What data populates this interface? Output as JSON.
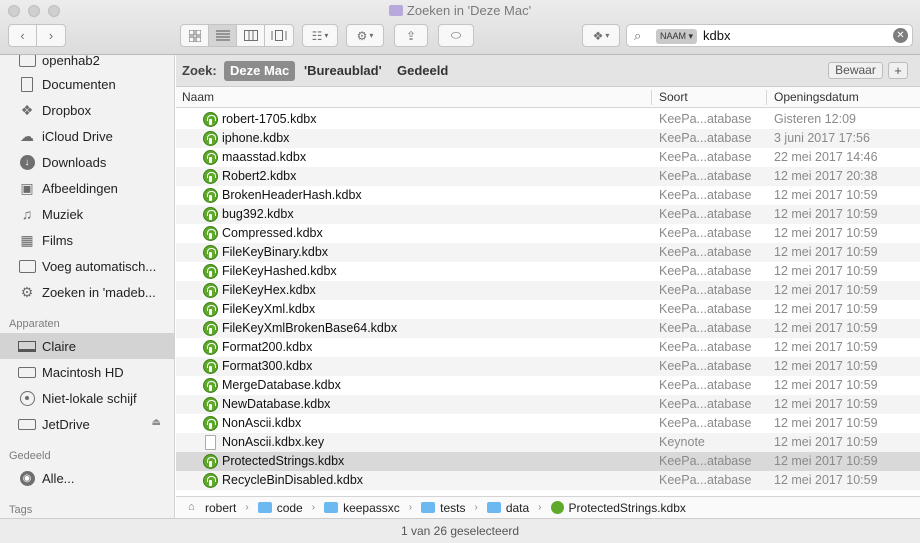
{
  "window": {
    "title": "Zoeken in 'Deze Mac'"
  },
  "toolbar": {
    "back_icon": "chevron-left-icon",
    "forward_icon": "chevron-right-icon",
    "search_token": "NAAM",
    "search_query": "kdbx"
  },
  "sidebar": {
    "top_items": [
      {
        "label": "openhab2",
        "icon": "folder-icon"
      },
      {
        "label": "Documenten",
        "icon": "documents-icon"
      },
      {
        "label": "Dropbox",
        "icon": "dropbox-icon"
      },
      {
        "label": "iCloud Drive",
        "icon": "cloud-icon"
      },
      {
        "label": "Downloads",
        "icon": "download-icon"
      },
      {
        "label": "Afbeeldingen",
        "icon": "camera-icon"
      },
      {
        "label": "Muziek",
        "icon": "music-icon"
      },
      {
        "label": "Films",
        "icon": "film-icon"
      },
      {
        "label": "Voeg automatisch...",
        "icon": "folder-icon"
      },
      {
        "label": "Zoeken in 'madeb...",
        "icon": "gear-icon"
      }
    ],
    "devices_heading": "Apparaten",
    "devices": [
      {
        "label": "Claire",
        "icon": "laptop-icon"
      },
      {
        "label": "Macintosh HD",
        "icon": "drive-icon"
      },
      {
        "label": "Niet-lokale schijf",
        "icon": "disc-icon"
      },
      {
        "label": "JetDrive",
        "icon": "drive-icon"
      }
    ],
    "shared_heading": "Gedeeld",
    "shared": [
      {
        "label": "Alle...",
        "icon": "network-icon"
      }
    ],
    "tags_heading": "Tags"
  },
  "scope": {
    "label": "Zoek:",
    "options": [
      "Deze Mac",
      "'Bureaublad'",
      "Gedeeld"
    ],
    "save_label": "Bewaar",
    "add_label": "+"
  },
  "columns": {
    "name": "Naam",
    "kind": "Soort",
    "date": "Openingsdatum"
  },
  "files": [
    {
      "name": "robert-1705.kdbx",
      "kind": "KeePa...atabase",
      "date": "Gisteren 12:09"
    },
    {
      "name": "iphone.kdbx",
      "kind": "KeePa...atabase",
      "date": "3 juni 2017 17:56"
    },
    {
      "name": "maasstad.kdbx",
      "kind": "KeePa...atabase",
      "date": "22 mei 2017 14:46"
    },
    {
      "name": "Robert2.kdbx",
      "kind": "KeePa...atabase",
      "date": "12 mei 2017 20:38"
    },
    {
      "name": "BrokenHeaderHash.kdbx",
      "kind": "KeePa...atabase",
      "date": "12 mei 2017 10:59"
    },
    {
      "name": "bug392.kdbx",
      "kind": "KeePa...atabase",
      "date": "12 mei 2017 10:59"
    },
    {
      "name": "Compressed.kdbx",
      "kind": "KeePa...atabase",
      "date": "12 mei 2017 10:59"
    },
    {
      "name": "FileKeyBinary.kdbx",
      "kind": "KeePa...atabase",
      "date": "12 mei 2017 10:59"
    },
    {
      "name": "FileKeyHashed.kdbx",
      "kind": "KeePa...atabase",
      "date": "12 mei 2017 10:59"
    },
    {
      "name": "FileKeyHex.kdbx",
      "kind": "KeePa...atabase",
      "date": "12 mei 2017 10:59"
    },
    {
      "name": "FileKeyXml.kdbx",
      "kind": "KeePa...atabase",
      "date": "12 mei 2017 10:59"
    },
    {
      "name": "FileKeyXmlBrokenBase64.kdbx",
      "kind": "KeePa...atabase",
      "date": "12 mei 2017 10:59"
    },
    {
      "name": "Format200.kdbx",
      "kind": "KeePa...atabase",
      "date": "12 mei 2017 10:59"
    },
    {
      "name": "Format300.kdbx",
      "kind": "KeePa...atabase",
      "date": "12 mei 2017 10:59"
    },
    {
      "name": "MergeDatabase.kdbx",
      "kind": "KeePa...atabase",
      "date": "12 mei 2017 10:59"
    },
    {
      "name": "NewDatabase.kdbx",
      "kind": "KeePa...atabase",
      "date": "12 mei 2017 10:59"
    },
    {
      "name": "NonAscii.kdbx",
      "kind": "KeePa...atabase",
      "date": "12 mei 2017 10:59"
    },
    {
      "name": "NonAscii.kdbx.key",
      "kind": "Keynote",
      "date": "12 mei 2017 10:59"
    },
    {
      "name": "ProtectedStrings.kdbx",
      "kind": "KeePa...atabase",
      "date": "12 mei 2017 10:59"
    },
    {
      "name": "RecycleBinDisabled.kdbx",
      "kind": "KeePa...atabase",
      "date": "12 mei 2017 10:59"
    }
  ],
  "selected_file_index": 18,
  "path": [
    "robert",
    "code",
    "keepassxc",
    "tests",
    "data",
    "ProtectedStrings.kdbx"
  ],
  "status": "1 van 26 geselecteerd"
}
